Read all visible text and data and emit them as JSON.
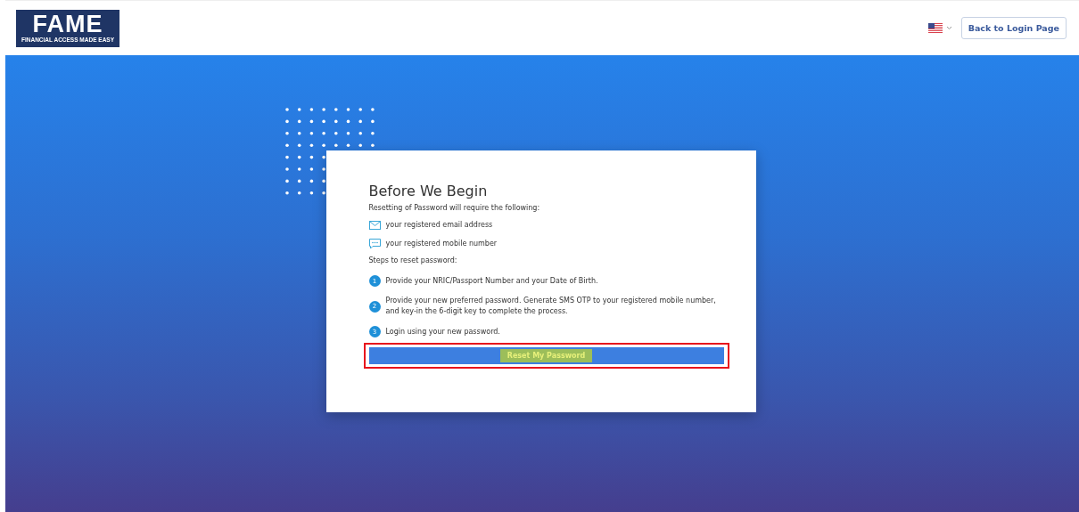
{
  "header": {
    "logo": {
      "title": "FAME",
      "tagline": "FINANCIAL ACCESS MADE EASY"
    },
    "back_button": "Back to Login Page"
  },
  "card": {
    "title": "Before We Begin",
    "intro": "Resetting of Password will require the following:",
    "requirements": [
      {
        "kind": "email",
        "text": "your registered email address"
      },
      {
        "kind": "sms",
        "text": "your registered mobile number"
      }
    ],
    "steps_heading": "Steps to reset password:",
    "steps": [
      {
        "number": "1",
        "text": "Provide your NRIC/Passport Number and your Date of Birth."
      },
      {
        "number": "2",
        "text": "Provide your new preferred password. Generate SMS OTP to your registered mobile number, and key-in the 6-digit key to complete the process."
      },
      {
        "number": "3",
        "text": "Login using your new password."
      }
    ],
    "button": {
      "label": "Reset My Password",
      "highlighted": true
    }
  }
}
